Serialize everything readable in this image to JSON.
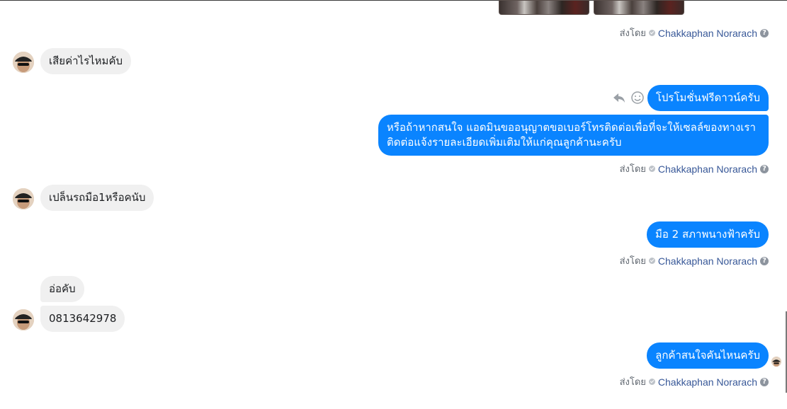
{
  "sender_name": "Chakkaphan Norarach",
  "sent_prefix": "ส่งโดย",
  "help_glyph": "?",
  "messages": {
    "m1": "เสียค่าไรไหมคับ",
    "m2": "โปรโมชั่นฟรีดาวน์ครับ",
    "m3": "หรือถ้าหากสนใจ แอดมินขออนุญาตขอเบอร์โทรติดต่อเพื่อที่จะให้เซลล์ของทางเราติดต่อแจ้งรายละเอียดเพิ่มเติมให้แก่คุณลูกค้านะครับ",
    "m4": "เปล็นรถมือ1หรือคนับ",
    "m5": "มือ 2 สภาพนางฟ้าครับ",
    "m6": "อ่อคับ",
    "m7": "0813642978",
    "m8": "ลูกค้าสนใจคันไหนครับ"
  },
  "icons": {
    "reply": "reply-icon",
    "react": "smiley-icon",
    "verified": "check-circle-icon",
    "help": "help-circle-icon"
  },
  "colors": {
    "outgoing_bubble": "#0a84ff",
    "incoming_bubble": "#f0f0f0",
    "sender_link": "#385898"
  }
}
